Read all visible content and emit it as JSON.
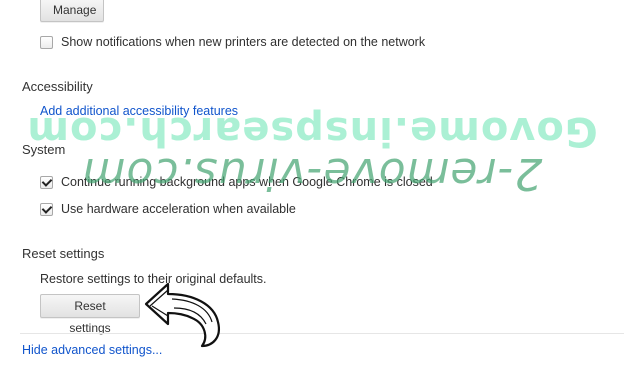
{
  "printers": {
    "manage_label": "Manage",
    "show_notifications_label": "Show notifications when new printers are detected on the network",
    "show_notifications_checked": false
  },
  "accessibility": {
    "title": "Accessibility",
    "link_label": "Add additional accessibility features"
  },
  "system": {
    "title": "System",
    "items": [
      {
        "label": "Continue running background apps when Google Chrome is closed",
        "checked": true
      },
      {
        "label": "Use hardware acceleration when available",
        "checked": true
      }
    ]
  },
  "reset": {
    "title": "Reset settings",
    "description": "Restore settings to their original defaults.",
    "button_label": "Reset settings"
  },
  "footer": {
    "hide_advanced_label": "Hide advanced settings..."
  },
  "watermark": {
    "line1": "Govome.inspsearch.com",
    "line2": "2-remove-virus.com",
    "color_line1": "#78e6b9",
    "color_line2": "#46a573"
  },
  "colors": {
    "link": "#1155cc",
    "text": "#303030"
  }
}
